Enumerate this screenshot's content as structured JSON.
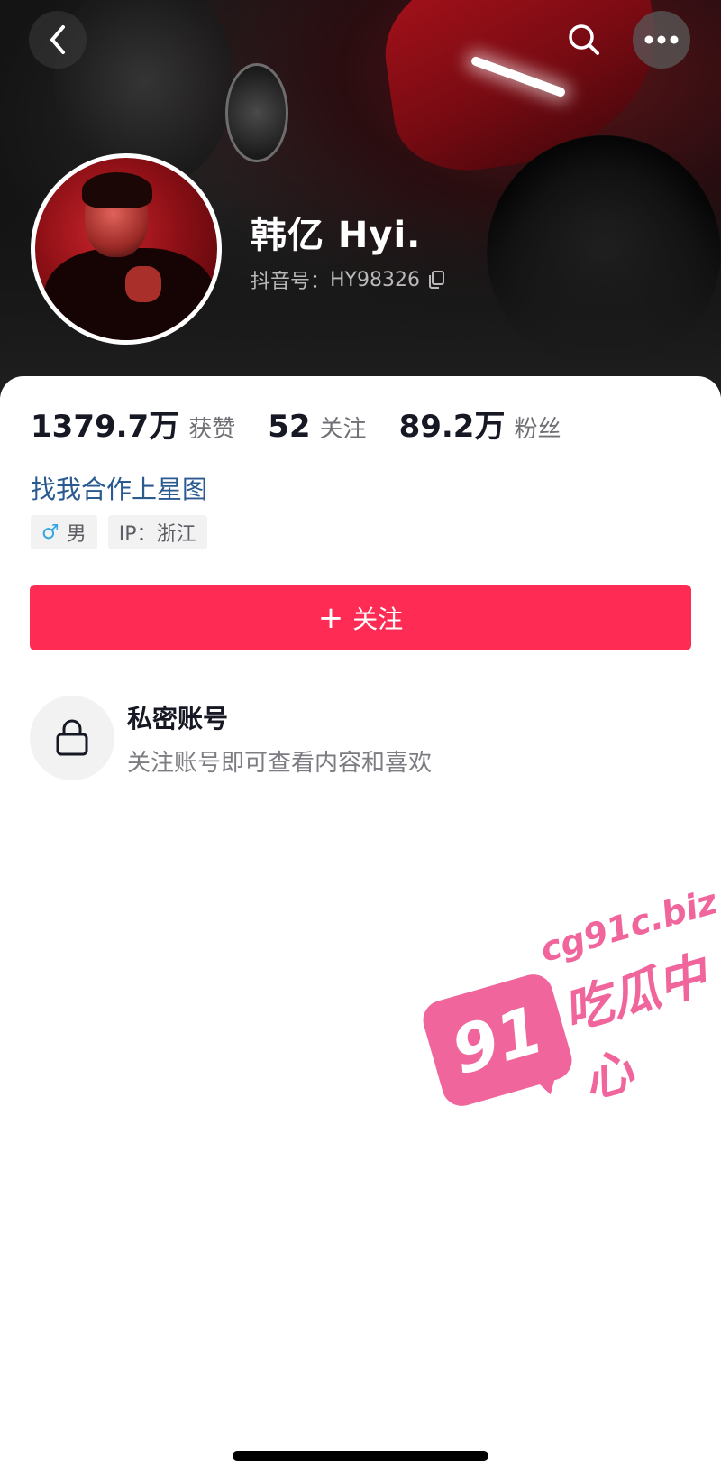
{
  "header": {
    "back_icon": "chevron-left-icon",
    "search_icon": "search-icon",
    "more_icon": "more-horizontal-icon"
  },
  "profile": {
    "name": "韩亿 Hyi.",
    "id_label": "抖音号：",
    "id_value": "HY98326",
    "copy_icon": "copy-icon"
  },
  "stats": [
    {
      "value": "1379.7万",
      "label": "获赞"
    },
    {
      "value": "52",
      "label": "关注"
    },
    {
      "value": "89.2万",
      "label": "粉丝"
    }
  ],
  "bio": {
    "cooperation_link": "找我合作上星图"
  },
  "tags": {
    "gender_symbol": "♂",
    "gender": "男",
    "ip": "IP：浙江"
  },
  "actions": {
    "follow_plus": "+",
    "follow_label": "关注"
  },
  "private_account": {
    "icon": "lock-icon",
    "title": "私密账号",
    "description": "关注账号即可查看内容和喜欢"
  },
  "watermark": {
    "badge": "91",
    "domain": "cg91c.biz",
    "text": "吃瓜中心"
  },
  "colors": {
    "follow_button": "#fe2c55",
    "link": "#2a5a8f",
    "gender_male": "#33a4e4",
    "watermark": "#f0669c"
  }
}
